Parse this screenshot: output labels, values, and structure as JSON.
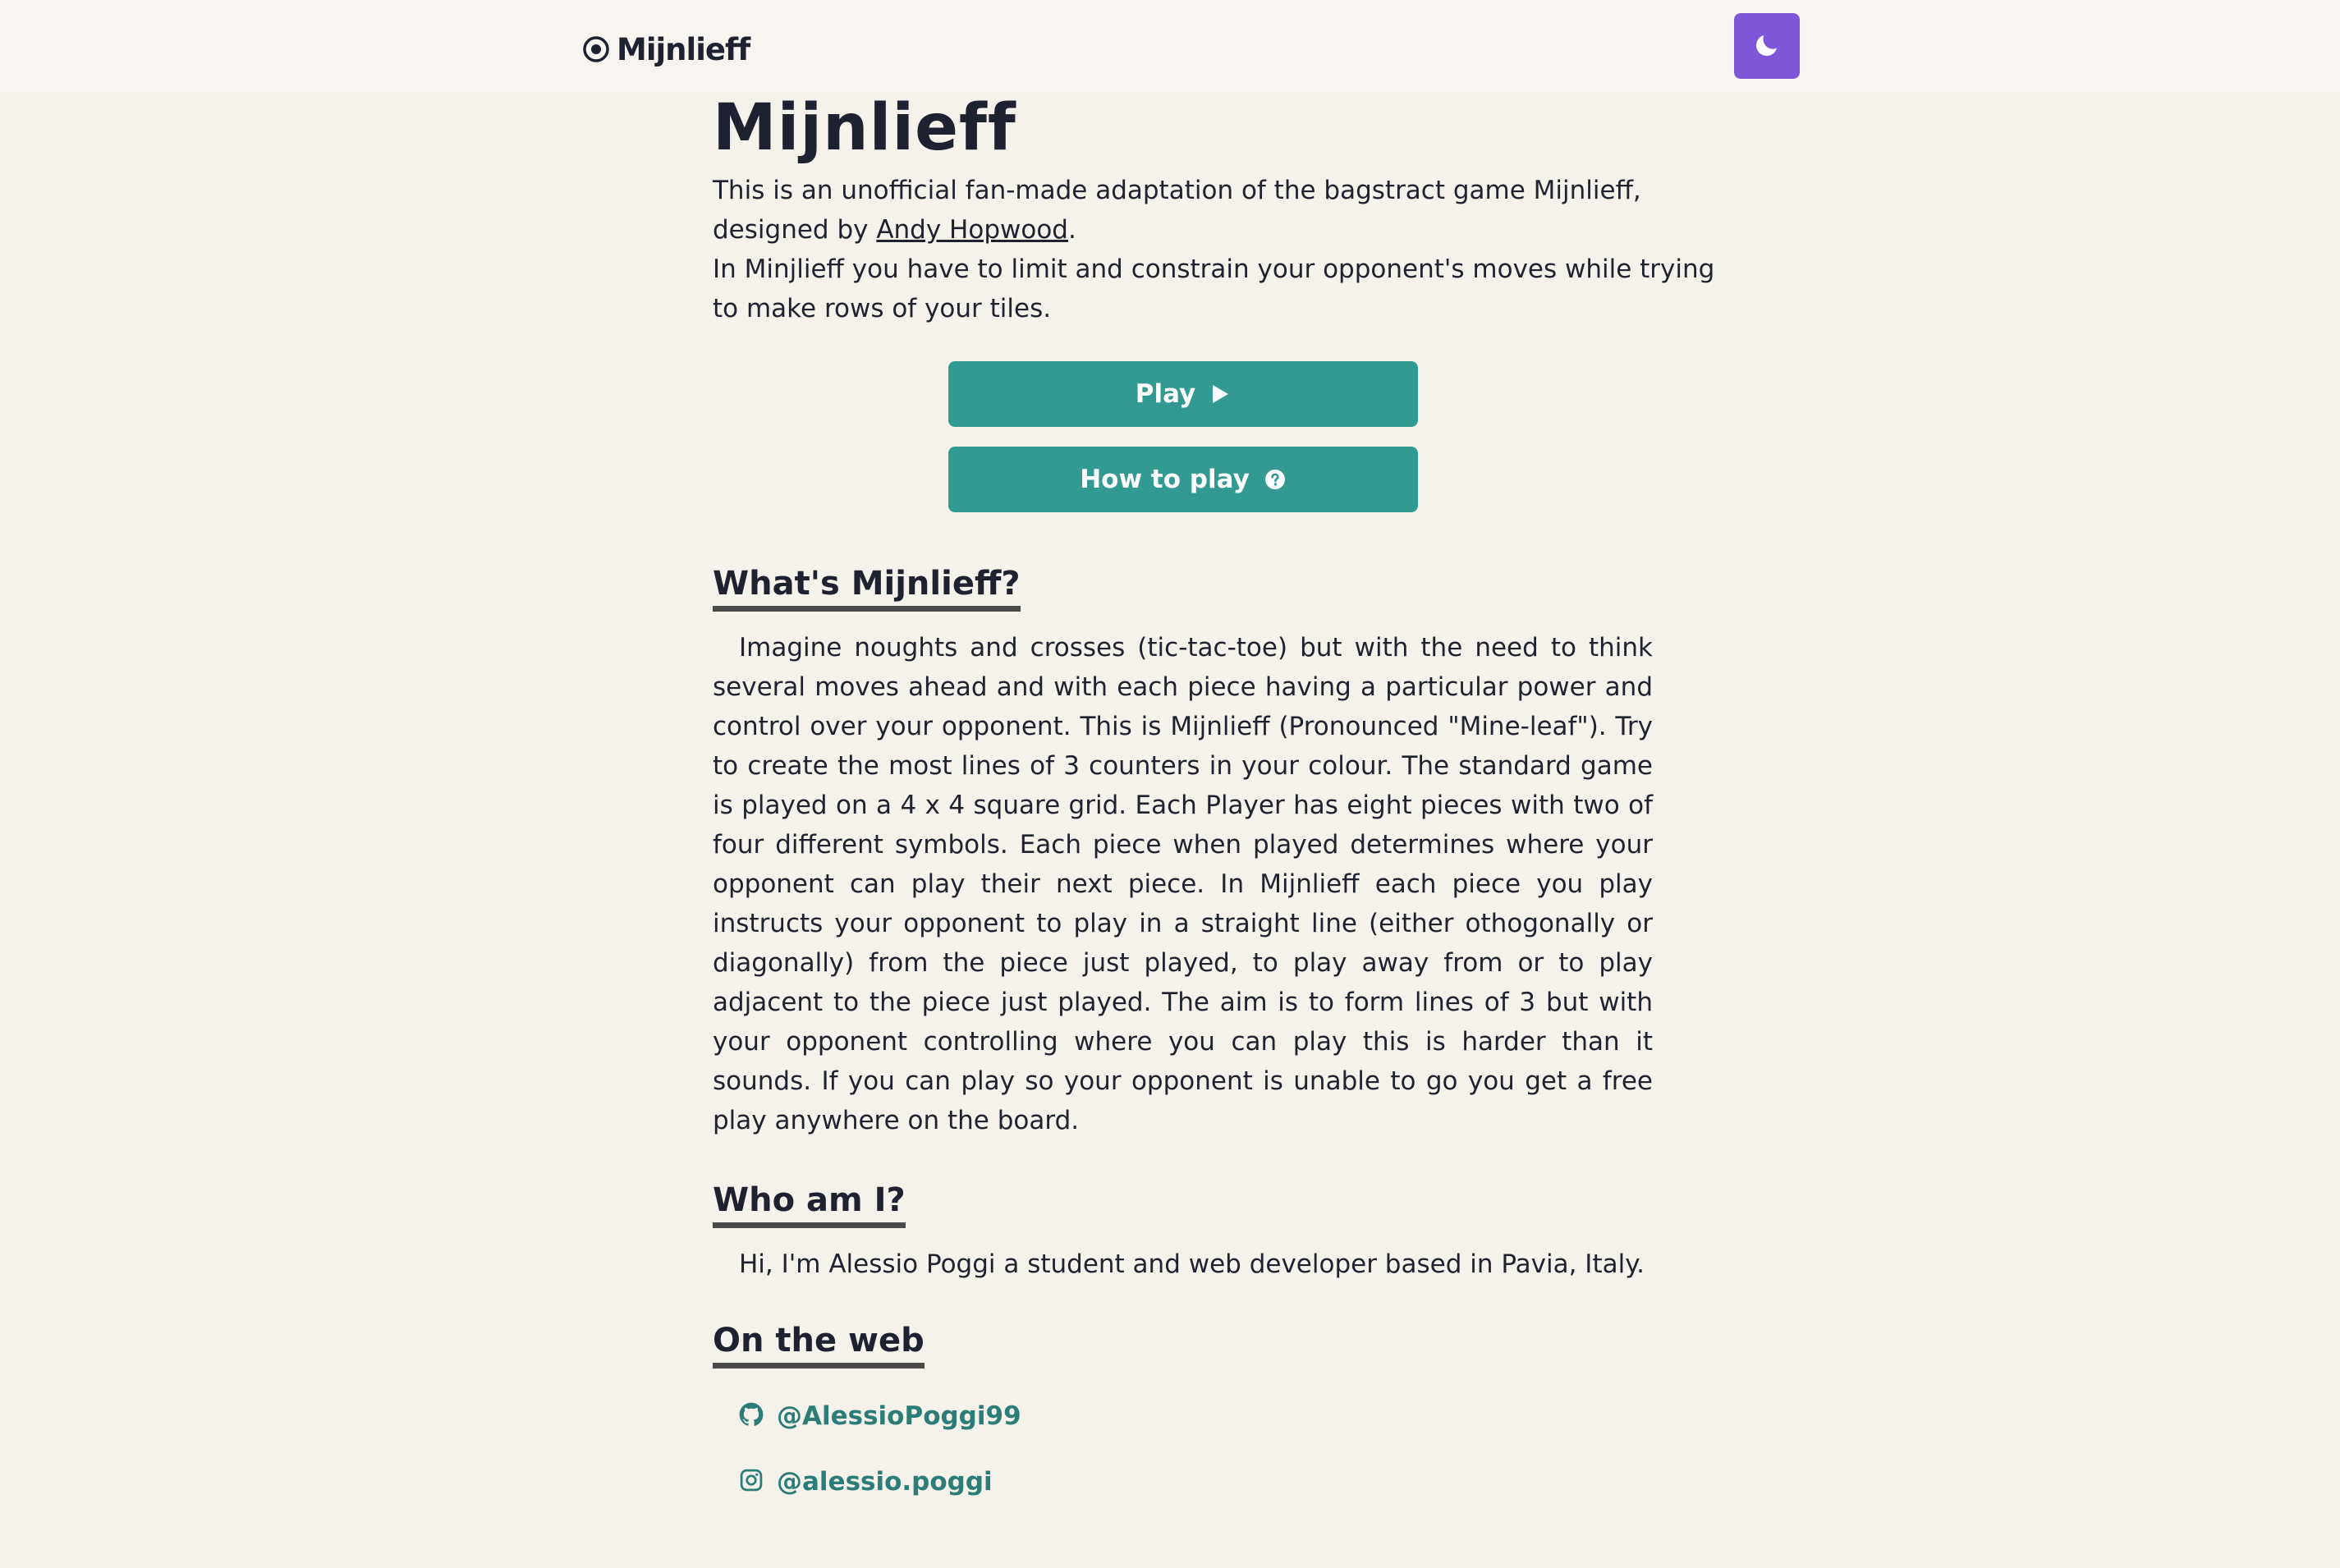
{
  "header": {
    "brand": "Mijnlieff",
    "brand_icon": "target-circle-icon",
    "theme_toggle_icon": "moon-icon",
    "accent": "#7e56d8"
  },
  "main": {
    "title": "Mijnlieff",
    "intro_line1": "This is an unofficial fan-made adaptation of the bagstract game Mijnlieff,",
    "intro_line2_prefix": "designed by ",
    "designer_link": "Andy Hopwood",
    "intro_line2_suffix": ".",
    "intro_line3": "In Minjlieff you have to limit and constrain your opponent's moves while trying",
    "intro_line4": "to make rows of your tiles.",
    "buttons": {
      "play": "Play",
      "play_icon": "play-icon",
      "how_to_play": "How to play",
      "how_to_play_icon": "question-circle-icon",
      "color": "#329993"
    }
  },
  "sections": {
    "what": {
      "heading": "What's Mijnlieff?",
      "body": "Imagine noughts and crosses (tic-tac-toe) but with the need to think several moves ahead and with each piece having a particular power and control over your opponent. This is Mijnlieff (Pronounced \"Mine-leaf\"). Try to create the most lines of 3 counters in your colour. The standard game is played on a 4 x 4 square grid. Each Player has eight pieces with two of four different symbols. Each piece when played determines where your opponent can play their next piece. In Mijnlieff each piece you play instructs your opponent to play in a straight line (either othogonally or diagonally) from the piece just played, to play away from or to play adjacent to the piece just played. The aim is to form lines of 3 but with your opponent controlling where you can play this is harder than it sounds. If you can play so your opponent is unable to go you get a free play anywhere on the board."
    },
    "who": {
      "heading": "Who am I?",
      "body": "Hi, I'm Alessio Poggi a student and web developer based in Pavia, Italy."
    },
    "web": {
      "heading": "On the web",
      "links": [
        {
          "icon": "github-icon",
          "label": "@AlessioPoggi99"
        },
        {
          "icon": "instagram-icon",
          "label": "@alessio.poggi"
        }
      ],
      "link_color": "#2c7d78"
    }
  }
}
